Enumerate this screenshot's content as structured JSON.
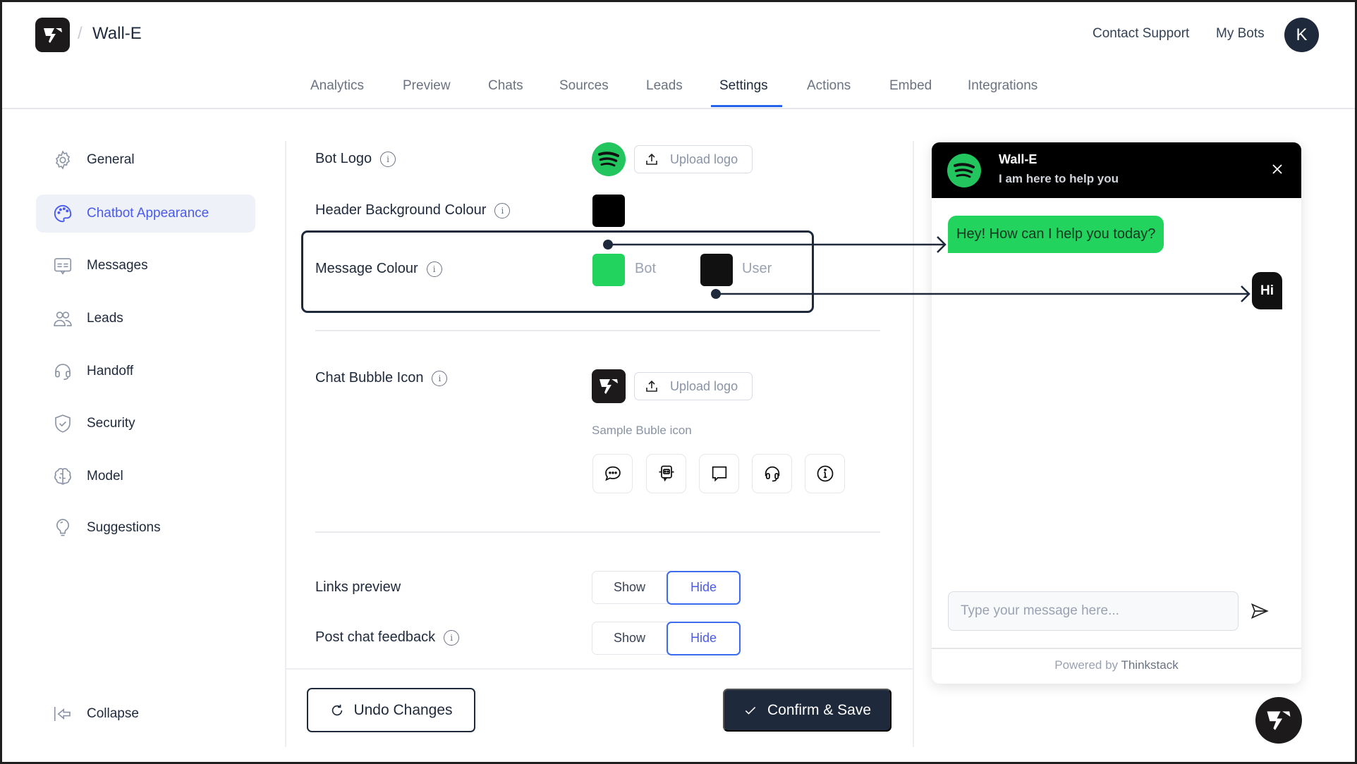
{
  "header": {
    "brand_icon": "thinkstack-logo",
    "separator": "/",
    "bot_name": "Wall-E",
    "links": [
      "Contact Support",
      "My Bots"
    ],
    "avatar_initial": "K"
  },
  "tabs": [
    {
      "label": "Analytics",
      "active": false
    },
    {
      "label": "Preview",
      "active": false
    },
    {
      "label": "Chats",
      "active": false
    },
    {
      "label": "Sources",
      "active": false
    },
    {
      "label": "Leads",
      "active": false
    },
    {
      "label": "Settings",
      "active": true
    },
    {
      "label": "Actions",
      "active": false
    },
    {
      "label": "Embed",
      "active": false
    },
    {
      "label": "Integrations",
      "active": false
    }
  ],
  "sidebar": {
    "items": [
      {
        "label": "General",
        "icon": "gear-icon",
        "active": false
      },
      {
        "label": "Chatbot Appearance",
        "icon": "palette-icon",
        "active": true
      },
      {
        "label": "Messages",
        "icon": "message-icon",
        "active": false
      },
      {
        "label": "Leads",
        "icon": "users-icon",
        "active": false
      },
      {
        "label": "Handoff",
        "icon": "headset-icon",
        "active": false
      },
      {
        "label": "Security",
        "icon": "shield-check-icon",
        "active": false
      },
      {
        "label": "Model",
        "icon": "brain-icon",
        "active": false
      },
      {
        "label": "Suggestions",
        "icon": "lightbulb-icon",
        "active": false
      }
    ],
    "collapse_label": "Collapse"
  },
  "settings": {
    "bot_logo": {
      "label": "Bot Logo",
      "upload_label": "Upload logo"
    },
    "header_bg": {
      "label": "Header Background Colour",
      "color": "#000000"
    },
    "message_colour": {
      "label": "Message Colour",
      "bot_label": "Bot",
      "bot_color": "#22d35e",
      "user_label": "User",
      "user_color": "#111111"
    },
    "chat_bubble_icon": {
      "label": "Chat Bubble Icon",
      "upload_label": "Upload logo",
      "sample_label": "Sample Buble icon",
      "samples": [
        "chat-dots-icon",
        "robot-chat-icon",
        "chat-square-icon",
        "headset-icon",
        "info-icon"
      ]
    },
    "links_preview": {
      "label": "Links preview",
      "options": [
        "Show",
        "Hide"
      ],
      "selected": "Hide"
    },
    "post_chat_feedback": {
      "label": "Post chat feedback",
      "options": [
        "Show",
        "Hide"
      ],
      "selected": "Hide"
    },
    "info_glyph": "i"
  },
  "footer": {
    "undo_label": "Undo Changes",
    "confirm_label": "Confirm & Save"
  },
  "widget": {
    "title": "Wall-E",
    "subtitle": "I am here to help you",
    "bot_message": "Hey! How can I help you today?",
    "user_message": "Hi",
    "input_placeholder": "Type your message here...",
    "powered_prefix": "Powered by",
    "powered_brand": "Thinkstack"
  },
  "colors": {
    "accent": "#4a5af0",
    "tab_underline": "#2563eb",
    "primary_dark": "#1e293b",
    "bot_green": "#22d35e"
  }
}
